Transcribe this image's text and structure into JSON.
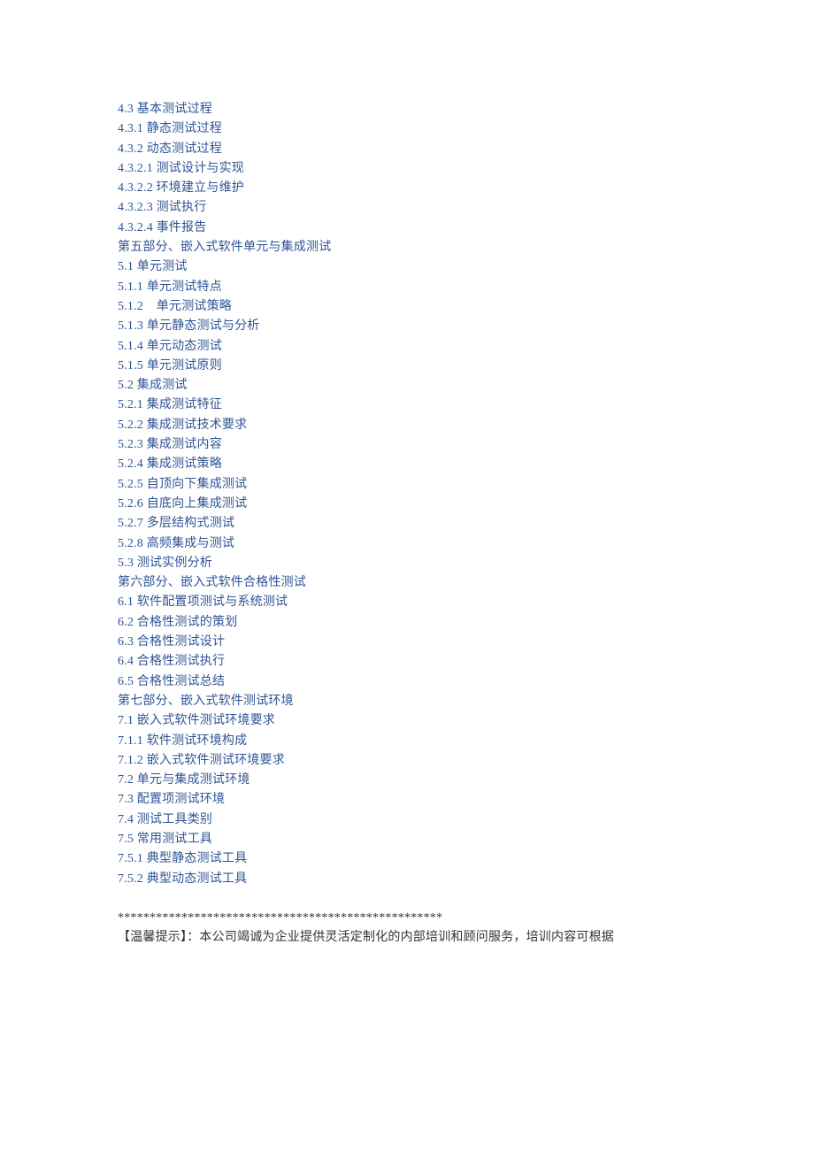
{
  "colors": {
    "toc": "#2f5496",
    "body": "#333333"
  },
  "toc": [
    "4.3 基本测试过程",
    "4.3.1 静态测试过程",
    "4.3.2 动态测试过程",
    "4.3.2.1 测试设计与实现",
    "4.3.2.2 环境建立与维护",
    "4.3.2.3 测试执行",
    "4.3.2.4 事件报告",
    "第五部分、嵌入式软件单元与集成测试",
    "5.1 单元测试",
    "5.1.1 单元测试特点",
    "5.1.2    单元测试策略",
    "5.1.3 单元静态测试与分析",
    "5.1.4 单元动态测试",
    "5.1.5 单元测试原则",
    "5.2 集成测试",
    "5.2.1 集成测试特征",
    "5.2.2 集成测试技术要求",
    "5.2.3 集成测试内容",
    "5.2.4 集成测试策略",
    "5.2.5 自顶向下集成测试",
    "5.2.6 自底向上集成测试",
    "5.2.7 多层结构式测试",
    "5.2.8 高频集成与测试",
    "5.3 测试实例分析",
    "第六部分、嵌入式软件合格性测试",
    "6.1 软件配置项测试与系统测试",
    "6.2 合格性测试的策划",
    "6.3 合格性测试设计",
    "6.4 合格性测试执行",
    "6.5 合格性测试总结",
    "第七部分、嵌入式软件测试环境",
    "7.1 嵌入式软件测试环境要求",
    "7.1.1 软件测试环境构成",
    "7.1.2 嵌入式软件测试环境要求",
    "7.2 单元与集成测试环境",
    "7.3 配置项测试环境",
    "7.4 测试工具类别",
    "7.5 常用测试工具",
    "7.5.1 典型静态测试工具",
    "7.5.2 典型动态测试工具"
  ],
  "separator": "***************************************************",
  "notice": {
    "label": "【温馨提示】",
    "text": "：本公司竭诚为企业提供灵活定制化的内部培训和顾问服务，培训内容可根据"
  }
}
